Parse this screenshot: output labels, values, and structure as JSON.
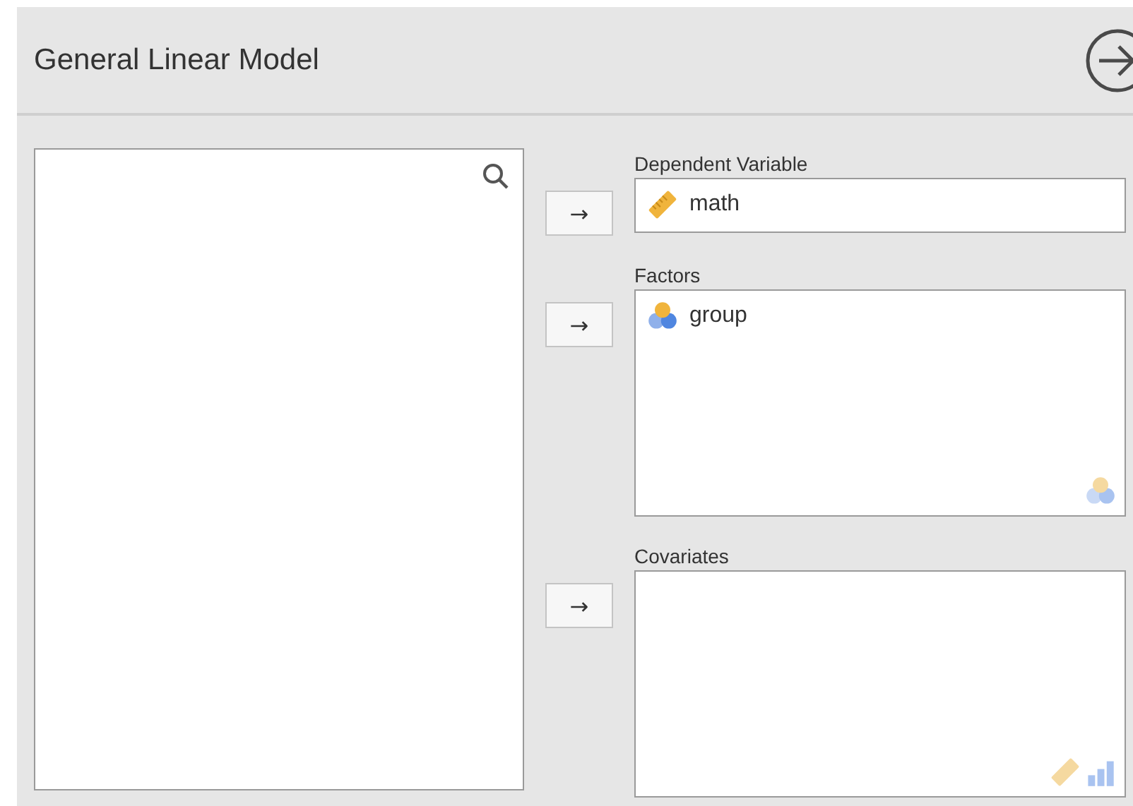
{
  "title": "General Linear Model",
  "targets": [
    {
      "button": "→",
      "label": "Dependent Variable",
      "kind": "single",
      "items": [
        {
          "name": "math",
          "kind": "scale"
        }
      ]
    },
    {
      "button": "→",
      "label": "Factors",
      "kind": "list",
      "items": [
        {
          "name": "group",
          "kind": "nominal"
        }
      ],
      "hints": [
        {
          "kind": "nominal"
        }
      ]
    },
    {
      "button": "→",
      "label": "Covariates",
      "kind": "list",
      "hints": [
        {
          "kind": "scale"
        },
        {
          "kind": "ordinal"
        }
      ]
    }
  ]
}
